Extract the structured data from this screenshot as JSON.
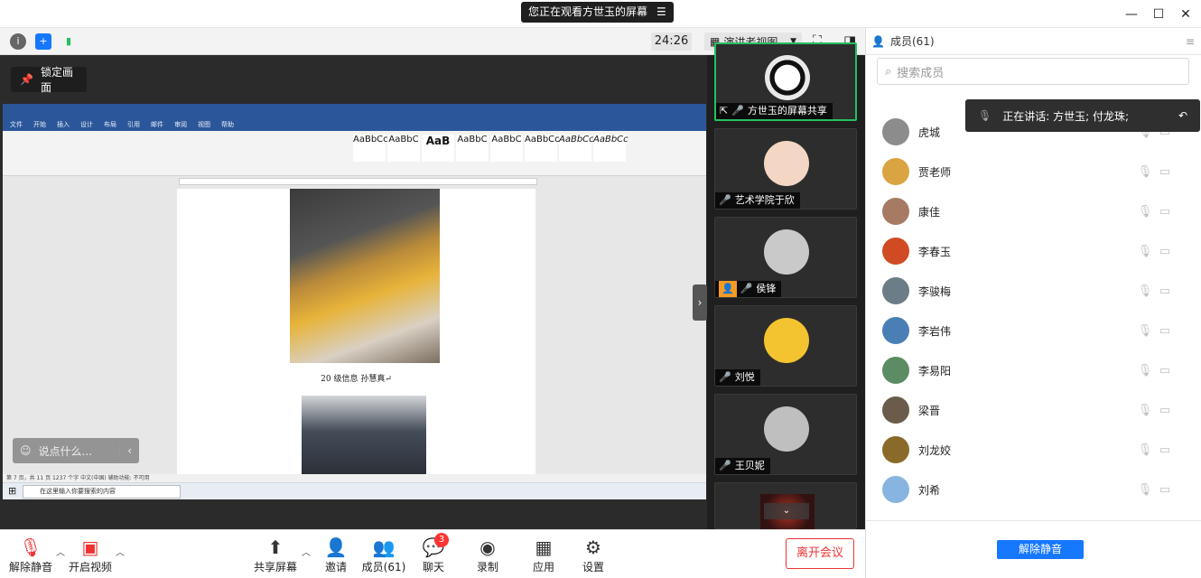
{
  "window": {
    "banner": "您正在观看方世玉的屏幕",
    "minimize_icon": "minimize-icon",
    "maximize_icon": "maximize-icon",
    "close_icon": "close-icon"
  },
  "toolbar": {
    "timer": "24:26",
    "view_mode": "演讲者视图",
    "lock_screen": "锁定画面"
  },
  "shared_doc": {
    "caption": "20 级信息 孙慧真↵",
    "status": "第 7 页，共 11 页   1237 个字   中文(中国)   辅助功能: 不可用",
    "taskbar_search": "在这里输入你要搜索的内容",
    "tabs": [
      "文件",
      "开始",
      "插入",
      "设计",
      "布局",
      "引用",
      "邮件",
      "审阅",
      "视图",
      "帮助"
    ],
    "styles": [
      "AaBbCcI",
      "AaBbC",
      "AaB",
      "AaBbC",
      "AaBbC",
      "AaBbCc",
      "AaBbCc",
      "AaBbCc"
    ]
  },
  "chat": {
    "placeholder": "说点什么..."
  },
  "thumbnails": [
    {
      "label": "方世玉的屏幕共享",
      "color": "#e9e9e9"
    },
    {
      "label": "艺术学院于欣",
      "color": "#f3d7c4"
    },
    {
      "label": "侯锋",
      "color": "#c9c9c9"
    },
    {
      "label": "刘悦",
      "color": "#f4c430"
    },
    {
      "label": "王贝妮",
      "color": "#bfbfbf"
    }
  ],
  "panel": {
    "title": "成员(61)",
    "search_placeholder": "搜索成员",
    "speaking": "正在讲话: 方世玉; 付龙珠;",
    "members": [
      {
        "name": "虎城",
        "color": "#8c8c8c"
      },
      {
        "name": "贾老师",
        "color": "#d9a441"
      },
      {
        "name": "康佳",
        "color": "#a77a63"
      },
      {
        "name": "李春玉",
        "color": "#d04a23"
      },
      {
        "name": "李骏梅",
        "color": "#6b7d87"
      },
      {
        "name": "李岩伟",
        "color": "#4a7fb5"
      },
      {
        "name": "李易阳",
        "color": "#5b8c63"
      },
      {
        "name": "梁晋",
        "color": "#6a5b4a"
      },
      {
        "name": "刘龙姣",
        "color": "#8a6a2a"
      },
      {
        "name": "刘希",
        "color": "#88b4e0"
      }
    ],
    "unmute_all": "解除静音"
  },
  "bottombar": {
    "unmute": "解除静音",
    "start_video": "开启视频",
    "share_screen": "共享屏幕",
    "invite": "邀请",
    "members": "成员(61)",
    "chat": "聊天",
    "chat_badge": "3",
    "record": "录制",
    "apps": "应用",
    "settings": "设置",
    "leave": "离开会议"
  },
  "colors": {
    "accent": "#1677ff",
    "active_border": "#23c15f",
    "leave": "#e33333"
  }
}
